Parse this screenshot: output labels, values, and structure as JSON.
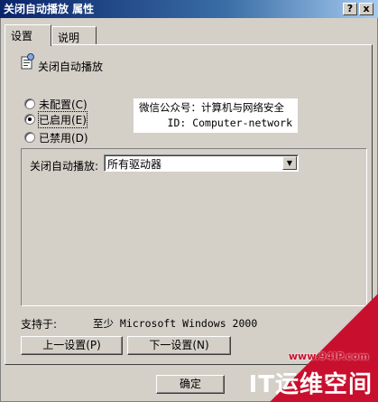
{
  "window": {
    "title": "关闭自动播放 属性",
    "help_button": "?",
    "close_button": "x"
  },
  "tabs": [
    {
      "label": "设置"
    },
    {
      "label": "说明"
    }
  ],
  "policy": {
    "name": "关闭自动播放"
  },
  "radios": [
    {
      "label": "未配置(C)",
      "checked": false
    },
    {
      "label": "已启用(E)",
      "checked": true
    },
    {
      "label": "已禁用(D)",
      "checked": false
    }
  ],
  "watermark": {
    "line1": "微信公众号：计算机与网络安全",
    "line2": "ID: Computer-network"
  },
  "options": {
    "label": "关闭自动播放:",
    "selected_value": "所有驱动器"
  },
  "support": {
    "label": "支持于:",
    "value": "至少 Microsoft Windows 2000"
  },
  "nav": {
    "prev": "上一设置(P)",
    "next": "下一设置(N)"
  },
  "footer": {
    "ok": "确定"
  },
  "branding": {
    "site": "www.94IP.com",
    "name": "IT运维空间"
  },
  "colors": {
    "title_bar": "#0a246a",
    "window_bg": "#d4d0c8",
    "brand_red": "#c8102e"
  }
}
